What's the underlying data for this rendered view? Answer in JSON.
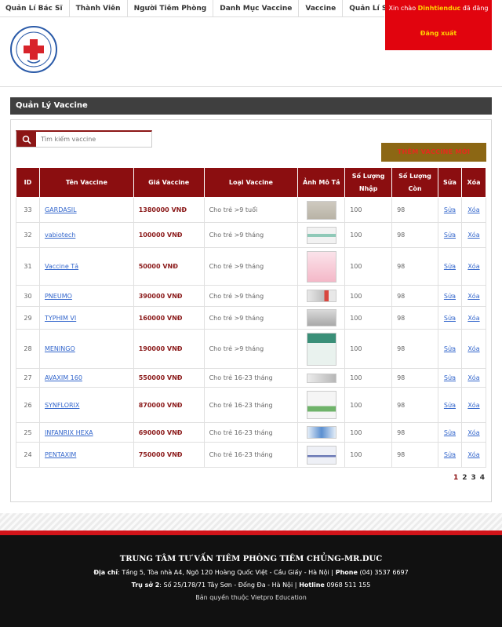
{
  "nav": {
    "items": [
      {
        "label": "Quản Lí Bác Sĩ"
      },
      {
        "label": "Thành Viên"
      },
      {
        "label": "Người Tiêm Phòng"
      },
      {
        "label": "Danh Mục Vaccine"
      },
      {
        "label": "Vaccine"
      },
      {
        "label": "Quản Lí Sổ Tiêm"
      }
    ]
  },
  "user": {
    "greet_prefix": "Xin chào ",
    "username": "Dinhtienduc",
    "greet_suffix": " đã đăng",
    "logout": "Đăng xuất"
  },
  "panel": {
    "title": "Quản Lý Vaccine"
  },
  "search": {
    "placeholder": "Tìm kiếm vaccine"
  },
  "add_button": "THÊM VACCINE MỚI",
  "table": {
    "headers": {
      "id": "ID",
      "name": "Tên Vaccine",
      "price": "Giá Vaccine",
      "type": "Loại Vaccine",
      "image": "Ảnh Mô Tả",
      "qty_in": "Số Lượng Nhập",
      "qty_left": "Số Lượng Còn",
      "edit": "Sửa",
      "delete": "Xóa"
    },
    "rows": [
      {
        "id": "33",
        "name": "GARDASIL",
        "price": "1380000 VNĐ",
        "type": "Cho trẻ >9 tuổi",
        "qty_in": "100",
        "qty_left": "98",
        "edit": "Sửa",
        "delete": "Xóa"
      },
      {
        "id": "32",
        "name": "vabiotech",
        "price": "100000 VNĐ",
        "type": "Cho trẻ >9 tháng",
        "qty_in": "100",
        "qty_left": "98",
        "edit": "Sửa",
        "delete": "Xóa"
      },
      {
        "id": "31",
        "name": "Vaccine Tả",
        "price": "50000 VNĐ",
        "type": "Cho trẻ >9 tháng",
        "qty_in": "100",
        "qty_left": "98",
        "edit": "Sửa",
        "delete": "Xóa"
      },
      {
        "id": "30",
        "name": "PNEUMO",
        "price": "390000 VNĐ",
        "type": "Cho trẻ >9 tháng",
        "qty_in": "100",
        "qty_left": "98",
        "edit": "Sửa",
        "delete": "Xóa"
      },
      {
        "id": "29",
        "name": "TYPHIM VI",
        "price": "160000 VNĐ",
        "type": "Cho trẻ >9 tháng",
        "qty_in": "100",
        "qty_left": "98",
        "edit": "Sửa",
        "delete": "Xóa"
      },
      {
        "id": "28",
        "name": "MENINGO",
        "price": "190000 VNĐ",
        "type": "Cho trẻ >9 tháng",
        "qty_in": "100",
        "qty_left": "98",
        "edit": "Sửa",
        "delete": "Xóa"
      },
      {
        "id": "27",
        "name": "AVAXIM 160",
        "price": "550000 VNĐ",
        "type": "Cho trẻ 16-23 tháng",
        "qty_in": "100",
        "qty_left": "98",
        "edit": "Sửa",
        "delete": "Xóa"
      },
      {
        "id": "26",
        "name": "SYNFLORIX",
        "price": "870000 VNĐ",
        "type": "Cho trẻ 16-23 tháng",
        "qty_in": "100",
        "qty_left": "98",
        "edit": "Sửa",
        "delete": "Xóa"
      },
      {
        "id": "25",
        "name": "INFANRIX HEXA",
        "price": "690000 VNĐ",
        "type": "Cho trẻ 16-23 tháng",
        "qty_in": "100",
        "qty_left": "98",
        "edit": "Sửa",
        "delete": "Xóa"
      },
      {
        "id": "24",
        "name": "PENTAXIM",
        "price": "750000 VNĐ",
        "type": "Cho trẻ 16-23 tháng",
        "qty_in": "100",
        "qty_left": "98",
        "edit": "Sửa",
        "delete": "Xóa"
      }
    ]
  },
  "pagination": [
    "1",
    "2",
    "3",
    "4"
  ],
  "footer": {
    "title": "TRUNG TÂM TƯ VẤN TIÊM PHÒNG TIÊM CHỦNG-MR.DUC",
    "addr_label": "Địa chỉ",
    "addr": ": Tầng 5, Tòa nhà A4, Ngõ 120 Hoàng Quốc Việt - Cầu Giấy - Hà Nội |",
    "phone_label": " Phone",
    "phone": " (04) 3537 6697",
    "addr2_label": "Trụ sở 2",
    "addr2": ": Số 25/178/71 Tây Sơn - Đống Đa - Hà Nội |",
    "hotline_label": " Hotline",
    "hotline": " 0968 511 155",
    "copyright": "Bản quyền thuộc Vietpro Education"
  },
  "colors": {
    "brand_red": "#8b0e10",
    "user_box": "#e1040e",
    "add_button": "#8c6714",
    "link": "#3366cc"
  }
}
